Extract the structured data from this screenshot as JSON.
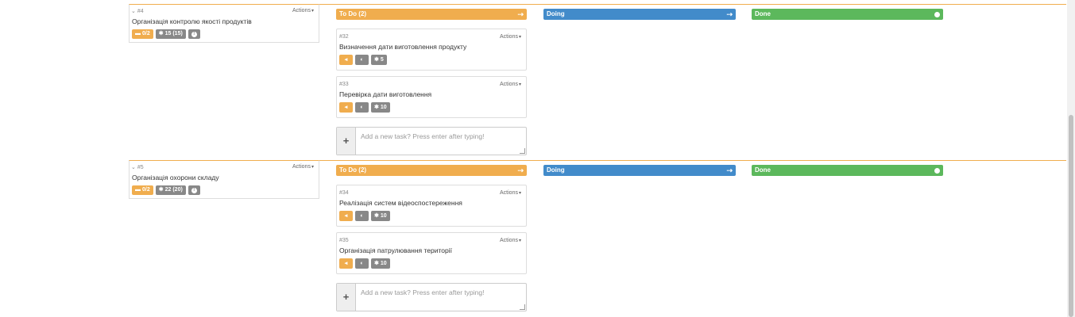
{
  "columns": {
    "todo": "To Do (2)",
    "doing": "Doing",
    "done": "Done"
  },
  "colors": {
    "todo": "#f0ad4e",
    "doing": "#428bca",
    "done": "#5cb85c",
    "badge_gray": "#888888"
  },
  "actions_label": "Actions",
  "add_task_placeholder": "Add a new task? Press enter after typing!",
  "stories": [
    {
      "number": "#4",
      "title": "Організація контролю якості продуктів",
      "tasks_badge": "0/2",
      "points_badge": "15 (15)",
      "tasks": [
        {
          "number": "#32",
          "title": "Визначення дати виготовлення продукту",
          "points": "5"
        },
        {
          "number": "#33",
          "title": "Перевірка дати виготовлення",
          "points": "10"
        }
      ]
    },
    {
      "number": "#5",
      "title": "Організація охорони складу",
      "tasks_badge": "0/2",
      "points_badge": "22 (20)",
      "tasks": [
        {
          "number": "#34",
          "title": "Реалізація систем відеоспостереження",
          "points": "10"
        },
        {
          "number": "#35",
          "title": "Організація патрулювання території",
          "points": "10"
        }
      ]
    }
  ],
  "icons": [
    "chevron-down-icon",
    "card-icon",
    "gear-icon",
    "info-icon",
    "arrow-left-icon",
    "half-circle-icon",
    "arrow-right-icon",
    "plus-icon"
  ]
}
